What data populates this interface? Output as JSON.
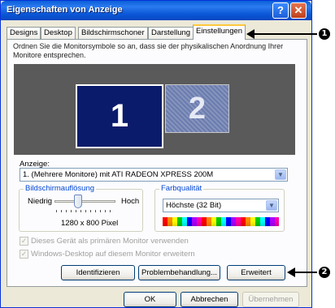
{
  "window": {
    "title": "Eigenschaften von Anzeige",
    "help_glyph": "?",
    "close_glyph": "✕"
  },
  "tabs": [
    {
      "label": "Designs"
    },
    {
      "label": "Desktop"
    },
    {
      "label": "Bildschirmschoner"
    },
    {
      "label": "Darstellung"
    },
    {
      "label": "Einstellungen",
      "active": true
    }
  ],
  "settings": {
    "description": "Ordnen Sie die Monitorsymbole so an, dass sie der physikalischen Anordnung Ihrer Monitore entsprechen.",
    "monitor1": "1",
    "monitor2": "2",
    "display_label": "Anzeige:",
    "display_value": "1. (Mehrere Monitore) mit ATI RADEON XPRESS 200M",
    "resolution": {
      "group_title": "Bildschirmauflösung",
      "low_label": "Niedrig",
      "high_label": "Hoch",
      "value": "1280 x 800 Pixel",
      "slider_level_fraction": 0.35
    },
    "color_quality": {
      "group_title": "Farbqualität",
      "value": "Höchste (32 Bit)"
    },
    "checkboxes": [
      {
        "label": "Dieses Gerät als primären Monitor verwenden",
        "checked": true,
        "disabled": true
      },
      {
        "label": "Windows-Desktop auf diesem Monitor erweitern",
        "checked": true,
        "disabled": true
      }
    ],
    "buttons": {
      "identify": "Identifizieren",
      "troubleshoot": "Problembehandlung...",
      "advanced": "Erweitert"
    }
  },
  "footer": {
    "ok": "OK",
    "cancel": "Abbrechen",
    "apply": "Übernehmen"
  },
  "callouts": [
    "1",
    "2"
  ],
  "colors": {
    "titlebar": "#0a5fd8",
    "monitor_bg": "#5a5a5a",
    "monitor1": "#0a1b6b",
    "group_title": "#0046d5"
  }
}
